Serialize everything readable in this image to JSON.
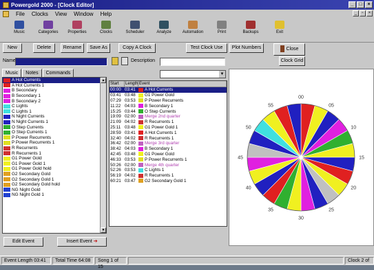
{
  "window": {
    "title": "Powergold 2000 - [Clock Editor]"
  },
  "menu": [
    "File",
    "Clocks",
    "View",
    "Window",
    "Help"
  ],
  "toolbar": [
    {
      "label": "Music",
      "color": "#3050a0"
    },
    {
      "label": "Categories",
      "color": "#7040a0"
    },
    {
      "label": "Properties",
      "color": "#b04060"
    },
    {
      "label": "Clocks",
      "color": "#608040"
    },
    {
      "label": "Scheduler",
      "color": "#405070"
    },
    {
      "label": "Analyze",
      "color": "#305060"
    },
    {
      "label": "Automation",
      "color": "#c08040"
    },
    {
      "label": "Print",
      "color": "#808080"
    },
    {
      "label": "Backups",
      "color": "#a03030"
    },
    {
      "label": "Exit",
      "color": "#e0c030"
    }
  ],
  "buttons": {
    "new": "New",
    "delete": "Delete",
    "rename": "Rename",
    "save_as": "Save As",
    "copy_clock": "Copy A Clock",
    "test_clock": "Test Clock Use",
    "plot_numbers": "Plot Numbers",
    "close": "Close",
    "clock_grid": "Clock Grid",
    "edit_event": "Edit Event",
    "insert_event": "Insert Event"
  },
  "fields": {
    "name_label": "Name",
    "name_value": "",
    "description_label": "Description",
    "description_value": ""
  },
  "tabs": [
    "Music",
    "Notes",
    "Commands"
  ],
  "events": [
    {
      "label": "A Hot Currents",
      "color": "#e02020",
      "selected": true
    },
    {
      "label": "A Hot Currents 1",
      "color": "#e02020"
    },
    {
      "label": "B Secondary",
      "color": "#e020e0"
    },
    {
      "label": "B Secondary 1",
      "color": "#e020e0"
    },
    {
      "label": "B Secondary 2",
      "color": "#e020e0"
    },
    {
      "label": "C Lights",
      "color": "#40e0e0"
    },
    {
      "label": "C Lights 1",
      "color": "#40e0e0"
    },
    {
      "label": "N Night Currents",
      "color": "#2020c0"
    },
    {
      "label": "N Night Currents 1",
      "color": "#2020c0"
    },
    {
      "label": "O Step Currents",
      "color": "#30b030"
    },
    {
      "label": "O Step Currents 1",
      "color": "#30b030"
    },
    {
      "label": "P Power Recurrents",
      "color": "#e0e020"
    },
    {
      "label": "P Power Recurrents 1",
      "color": "#e0e020"
    },
    {
      "label": "R Recurrents",
      "color": "#d03030"
    },
    {
      "label": "R Recurrents 1",
      "color": "#d03030"
    },
    {
      "label": "G1 Power Gold",
      "color": "#f0f020"
    },
    {
      "label": "G1 Power Gold 1",
      "color": "#f0f020"
    },
    {
      "label": "G1 Power Gold hold",
      "color": "#f0f020"
    },
    {
      "label": "G2 Secondary Gold",
      "color": "#e0a020"
    },
    {
      "label": "G2 Secondary Gold 1",
      "color": "#e0a020"
    },
    {
      "label": "G2 Secondary Gold hold",
      "color": "#e0a020"
    },
    {
      "label": "NG Night Gold",
      "color": "#2040d0"
    },
    {
      "label": "NG Night Gold 1",
      "color": "#2040d0"
    }
  ],
  "clock_grid": {
    "headers": [
      "Start",
      "Length",
      "Event"
    ],
    "rows": [
      {
        "start": "00:00",
        "length": "03:41",
        "event": "A Hot Currents",
        "color": "#e02020",
        "selected": true
      },
      {
        "start": "03:41",
        "length": "03:48",
        "event": "G1 Power Gold",
        "color": "#f0f020"
      },
      {
        "start": "07:29",
        "length": "03:53",
        "event": "P Power Recurrents",
        "color": "#e0e020"
      },
      {
        "start": "11:22",
        "length": "04:03",
        "event": "B Secondary 1",
        "color": "#e020e0"
      },
      {
        "start": "15:25",
        "length": "03:44",
        "event": "O Step Currents",
        "color": "#30b030"
      },
      {
        "start": "19:09",
        "length": "02:00",
        "event": "Merge 2nd quarter",
        "color": "#c060c0"
      },
      {
        "start": "21:09",
        "length": "04:02",
        "event": "R Recurrents 1",
        "color": "#d03030"
      },
      {
        "start": "25:11",
        "length": "03:48",
        "event": "G1 Power Gold 1",
        "color": "#f0f020"
      },
      {
        "start": "28:59",
        "length": "03:41",
        "event": "A Hot Currents 1",
        "color": "#e02020"
      },
      {
        "start": "32:40",
        "length": "04:02",
        "event": "R Recurrents 1",
        "color": "#d03030"
      },
      {
        "start": "36:42",
        "length": "02:00",
        "event": "Merge 3rd quarter",
        "color": "#c060c0"
      },
      {
        "start": "38:42",
        "length": "04:03",
        "event": "B Secondary 1",
        "color": "#e020e0"
      },
      {
        "start": "42:45",
        "length": "03:48",
        "event": "G1 Power Gold",
        "color": "#f0f020"
      },
      {
        "start": "46:33",
        "length": "03:53",
        "event": "P Power Recurrents 1",
        "color": "#e0e020"
      },
      {
        "start": "50:26",
        "length": "02:00",
        "event": "Merge 4th quarter",
        "color": "#c060c0"
      },
      {
        "start": "52:26",
        "length": "03:53",
        "event": "C Lights 1",
        "color": "#40e0e0"
      },
      {
        "start": "56:19",
        "length": "04:02",
        "event": "R Recurrents 1",
        "color": "#d03030"
      },
      {
        "start": "60:21",
        "length": "03:47",
        "event": "G2 Secondary Gold 1",
        "color": "#e0a020"
      }
    ]
  },
  "clock": {
    "labels": [
      "00",
      "05",
      "10",
      "15",
      "20",
      "25",
      "30",
      "35",
      "40",
      "45",
      "50",
      "55"
    ],
    "segments": [
      "#e02020",
      "#f0f020",
      "#2020c0",
      "#e020e0",
      "#30b030",
      "#f0f020",
      "#2020c0",
      "#e02020",
      "#f0f020",
      "#c0c0c0",
      "#2020c0",
      "#e020e0",
      "#f0f020",
      "#30b030",
      "#e02020",
      "#2020c0",
      "#f0f020",
      "#e020e0",
      "#c0c0c0",
      "#2020c0",
      "#40e0e0",
      "#f0f020",
      "#e02020",
      "#2020c0"
    ]
  },
  "status": {
    "event_length": "Event Length 03:41",
    "total_time": "Total Time 64:08",
    "song": "Song 1 of 15",
    "clock": "Clock 2 of"
  }
}
